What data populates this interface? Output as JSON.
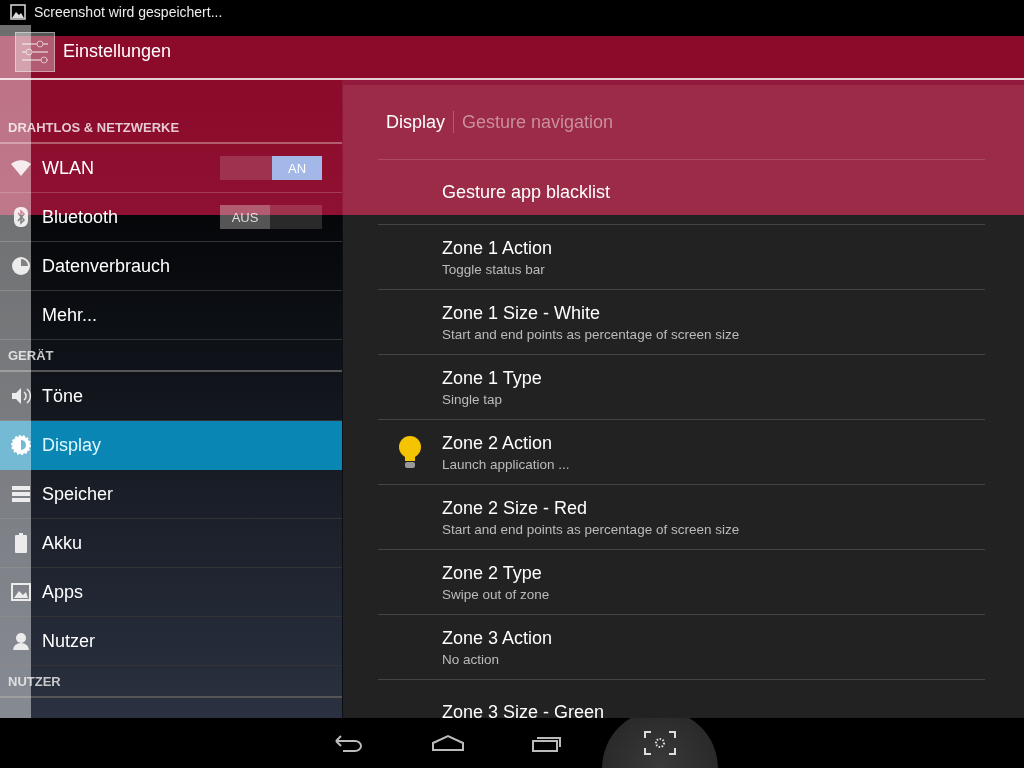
{
  "status_bar": {
    "notification": "Screenshot wird gespeichert..."
  },
  "action_bar": {
    "title": "Einstellungen"
  },
  "sidebar": {
    "groups": [
      {
        "header": "DRAHTLOS & NETZWERKE",
        "items": [
          {
            "label": "WLAN",
            "kind": "toggle",
            "on": true,
            "switch_label": "AN",
            "selected": false
          },
          {
            "label": "Bluetooth",
            "kind": "toggle",
            "on": false,
            "switch_label": "AUS",
            "selected": false
          },
          {
            "label": "Datenverbrauch",
            "kind": "plain",
            "selected": false
          },
          {
            "label": "Mehr...",
            "kind": "plain",
            "selected": false
          }
        ]
      },
      {
        "header": "GERÄT",
        "items": [
          {
            "label": "Töne",
            "kind": "plain",
            "selected": false
          },
          {
            "label": "Display",
            "kind": "plain",
            "selected": true
          },
          {
            "label": "Speicher",
            "kind": "plain",
            "selected": false
          },
          {
            "label": "Akku",
            "kind": "plain",
            "selected": false
          },
          {
            "label": "Apps",
            "kind": "plain",
            "selected": false
          },
          {
            "label": "Nutzer",
            "kind": "plain",
            "selected": false
          }
        ]
      },
      {
        "header": "NUTZER"
      }
    ]
  },
  "detail": {
    "breadcrumb": [
      {
        "label": "Display",
        "selected": true
      },
      {
        "label": "Gesture navigation",
        "selected": false
      }
    ],
    "rows": [
      {
        "title": "Gesture app blacklist",
        "kind": "plain"
      },
      {
        "title": "Zone 1 Action",
        "summary": "Toggle status bar",
        "kind": "plain"
      },
      {
        "title": "Zone 1 Size - White",
        "summary": "Start and end points as percentage of screen size",
        "kind": "plain"
      },
      {
        "title": "Zone 1 Type",
        "summary": "Single tap",
        "kind": "plain"
      },
      {
        "title": "Zone 2 Action",
        "summary": "Launch application ...",
        "kind": "app"
      },
      {
        "title": "Zone 2 Size - Red",
        "summary": "Start and end points as percentage of screen size",
        "kind": "plain"
      },
      {
        "title": "Zone 2 Type",
        "summary": "Swipe out of zone",
        "kind": "plain"
      },
      {
        "title": "Zone 3 Action",
        "summary": "No action",
        "kind": "plain"
      },
      {
        "title": "Zone 3 Size - Green",
        "kind": "plain"
      }
    ]
  },
  "gesture_zones": [
    {
      "kind": "top-band",
      "color": "#8c0a2a"
    },
    {
      "kind": "left-edge",
      "color": "#6e6e6e"
    }
  ]
}
